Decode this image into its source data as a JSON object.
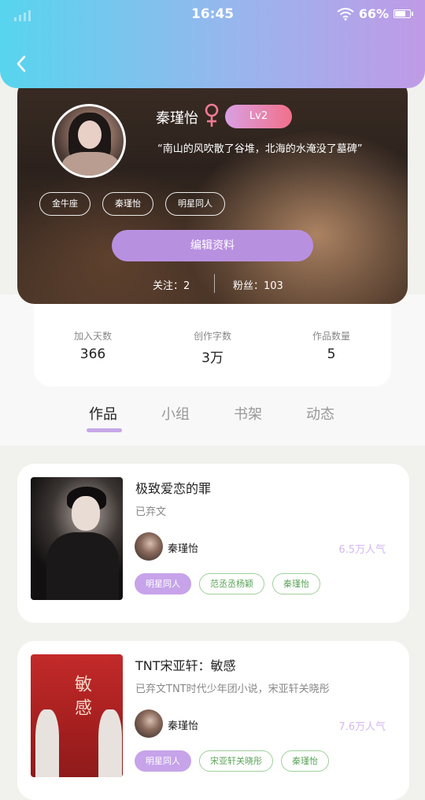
{
  "status_bar": {
    "time": "16:45",
    "battery": "66%"
  },
  "profile": {
    "name": "秦瑾怡",
    "level": "Lv2",
    "motto": "“南山的风吹散了谷堆，北海的水淹没了墓碑”",
    "tags": [
      "金牛座",
      "秦瑾怡",
      "明星同人"
    ],
    "edit_label": "编辑资料",
    "follow_text": "关注：2",
    "fans_text": "粉丝：103"
  },
  "stats": [
    {
      "label": "加入天数",
      "value": "366"
    },
    {
      "label": "创作字数",
      "value": "3万"
    },
    {
      "label": "作品数量",
      "value": "5"
    }
  ],
  "tabs": [
    "作品",
    "小组",
    "书架",
    "动态"
  ],
  "works": [
    {
      "title": "极致爱恋的罪",
      "desc": "已弃文",
      "author": "秦瑾怡",
      "popularity": "6.5万人气",
      "tags": [
        "明星同人",
        "范丞丞杨颖",
        "秦瑾怡"
      ]
    },
    {
      "title": "TNT宋亚轩：敏感",
      "desc": "已弃文TNT时代少年团小说，宋亚轩关晓彤",
      "cover_text": "敏感",
      "author": "秦瑾怡",
      "popularity": "7.6万人气",
      "tags": [
        "明星同人",
        "宋亚轩关晓彤",
        "秦瑾怡"
      ]
    }
  ],
  "colors": {
    "accent": "#b890e0",
    "gradient_start": "#57d5ee",
    "gradient_end": "#c09ae6",
    "tag_green": "#9fcf9b"
  }
}
